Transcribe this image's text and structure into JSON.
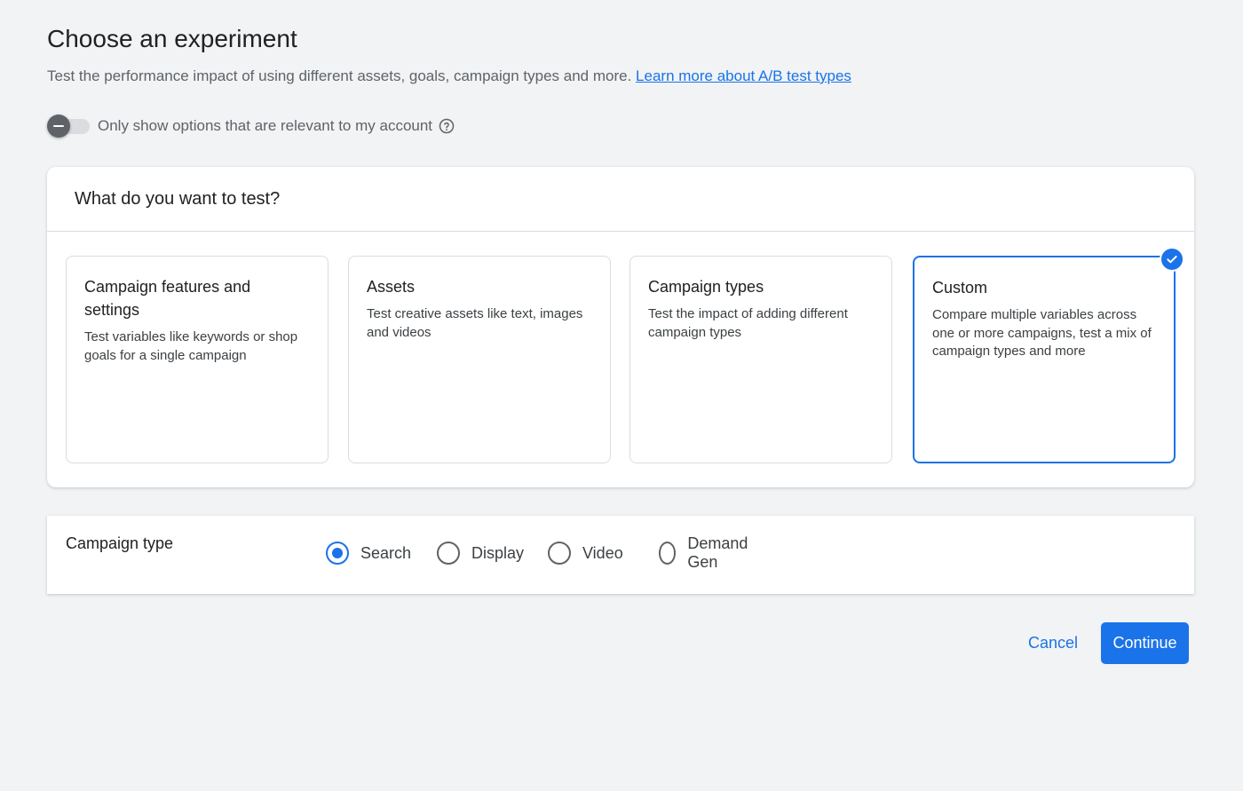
{
  "header": {
    "title": "Choose an experiment",
    "subtitle": "Test the performance impact of using different assets, goals, campaign types and more.",
    "learn_more_link": "Learn more about A/B test types"
  },
  "toggle": {
    "label": "Only show options that are relevant to my account",
    "state": "off",
    "help_icon": "help-circle-icon"
  },
  "test_section": {
    "heading": "What do you want to test?",
    "options": [
      {
        "title": "Campaign features and settings",
        "description": "Test variables like keywords or shop goals for a single campaign",
        "selected": false
      },
      {
        "title": "Assets",
        "description": "Test creative assets like text, images and videos",
        "selected": false
      },
      {
        "title": "Campaign types",
        "description": "Test the impact of adding different campaign types",
        "selected": false
      },
      {
        "title": "Custom",
        "description": "Compare multiple variables across one or more campaigns, test a mix of campaign types and more",
        "selected": true
      }
    ]
  },
  "campaign_type": {
    "label": "Campaign type",
    "options": [
      "Search",
      "Display",
      "Video",
      "Demand Gen"
    ],
    "selected": "Search"
  },
  "actions": {
    "cancel_label": "Cancel",
    "continue_label": "Continue"
  },
  "colors": {
    "accent": "#1a73e8",
    "background": "#f1f3f4",
    "card": "#ffffff",
    "border": "#dadce0",
    "text_primary": "#202124",
    "text_secondary": "#5f6368"
  }
}
